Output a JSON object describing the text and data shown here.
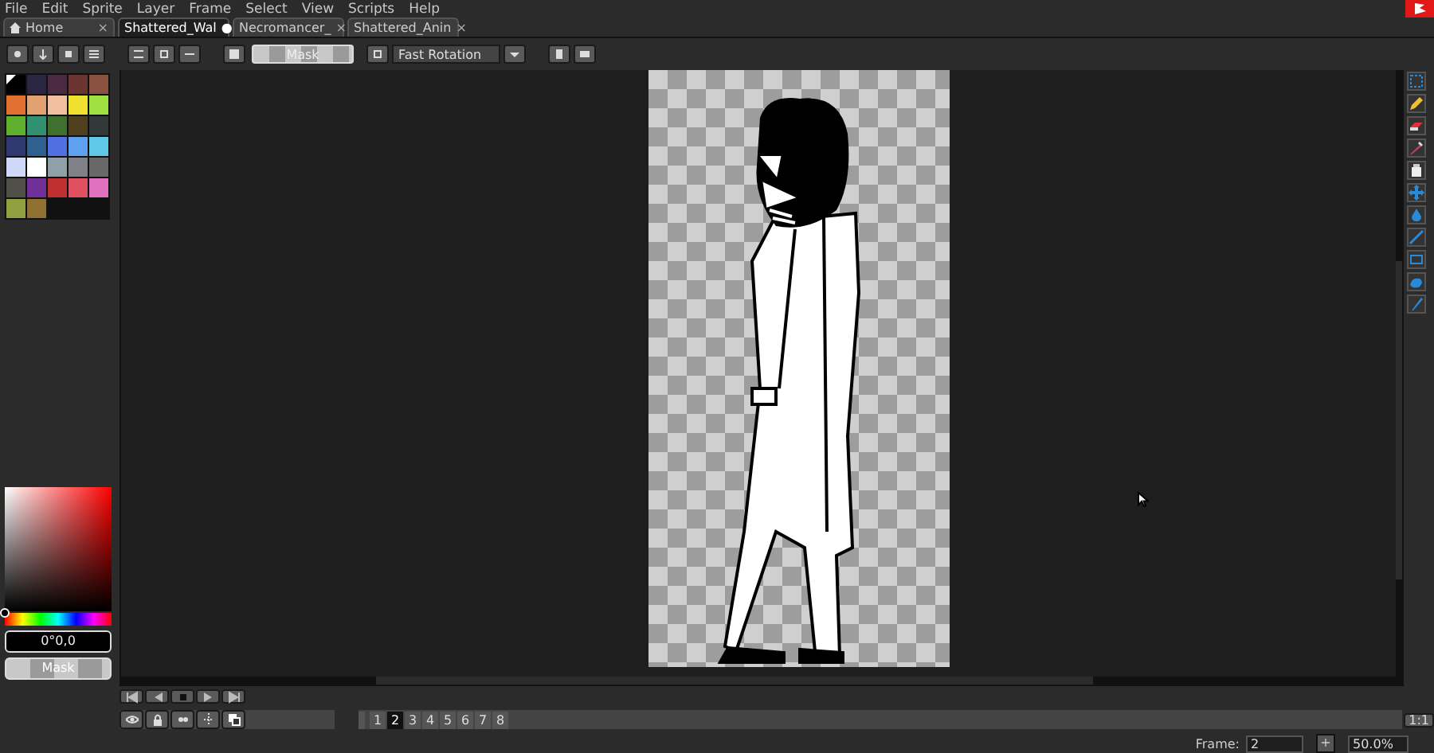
{
  "menu": [
    "File",
    "Edit",
    "Sprite",
    "Layer",
    "Frame",
    "Select",
    "View",
    "Scripts",
    "Help"
  ],
  "tabs": [
    {
      "label": "Home",
      "kind": "home",
      "close": "×",
      "selected": false
    },
    {
      "label": "Shattered_Wal",
      "kind": "file",
      "close": "●",
      "selected": true
    },
    {
      "label": "Necromancer_",
      "kind": "file",
      "close": "×",
      "selected": false
    },
    {
      "label": "Shattered_Anin",
      "kind": "file",
      "close": "×",
      "selected": false
    }
  ],
  "toolbar": {
    "mask_button": "Mask",
    "rotation": {
      "value": "Fast Rotation"
    }
  },
  "palette": {
    "swatches": [
      {
        "color": "#000000",
        "kind": "transparent"
      },
      {
        "color": "#2a2540",
        "kind": "color"
      },
      {
        "color": "#4a2a40",
        "kind": "color"
      },
      {
        "color": "#6a3530",
        "kind": "color"
      },
      {
        "color": "#8a5040",
        "kind": "color"
      },
      {
        "color": "#e07030",
        "kind": "color"
      },
      {
        "color": "#e0a070",
        "kind": "color"
      },
      {
        "color": "#f0c0a0",
        "kind": "color"
      },
      {
        "color": "#f0e030",
        "kind": "color"
      },
      {
        "color": "#a0e040",
        "kind": "color"
      },
      {
        "color": "#60b030",
        "kind": "color"
      },
      {
        "color": "#309070",
        "kind": "color"
      },
      {
        "color": "#407030",
        "kind": "color"
      },
      {
        "color": "#504020",
        "kind": "color"
      },
      {
        "color": "#303838",
        "kind": "color"
      },
      {
        "color": "#303870",
        "kind": "color"
      },
      {
        "color": "#306090",
        "kind": "color"
      },
      {
        "color": "#5070e0",
        "kind": "color"
      },
      {
        "color": "#60a0f0",
        "kind": "color"
      },
      {
        "color": "#60c8e8",
        "kind": "color"
      },
      {
        "color": "#d0d8f8",
        "kind": "color"
      },
      {
        "color": "#ffffff",
        "kind": "color"
      },
      {
        "color": "#90a0a8",
        "kind": "color"
      },
      {
        "color": "#808088",
        "kind": "color"
      },
      {
        "color": "#686868",
        "kind": "color"
      },
      {
        "color": "#505048",
        "kind": "color"
      },
      {
        "color": "#703098",
        "kind": "color"
      },
      {
        "color": "#c03030",
        "kind": "color"
      },
      {
        "color": "#e05060",
        "kind": "color"
      },
      {
        "color": "#e070c0",
        "kind": "color"
      },
      {
        "color": "#90a040",
        "kind": "color"
      },
      {
        "color": "#907030",
        "kind": "color"
      }
    ]
  },
  "color_picker": {
    "hue": {
      "level": 0
    },
    "readout": "0°0,0",
    "mask_button": "Mask"
  },
  "frames": [
    {
      "label": "1",
      "selected": false
    },
    {
      "label": "2",
      "selected": true
    },
    {
      "label": "3",
      "selected": false
    },
    {
      "label": "4",
      "selected": false
    },
    {
      "label": "5",
      "selected": false
    },
    {
      "label": "6",
      "selected": false
    },
    {
      "label": "7",
      "selected": false
    },
    {
      "label": "8",
      "selected": false
    }
  ],
  "status": {
    "one_to_one": "1:1",
    "frame_label": "Frame:",
    "frame_value": "2",
    "add": "+",
    "zoom": "50.0%"
  }
}
